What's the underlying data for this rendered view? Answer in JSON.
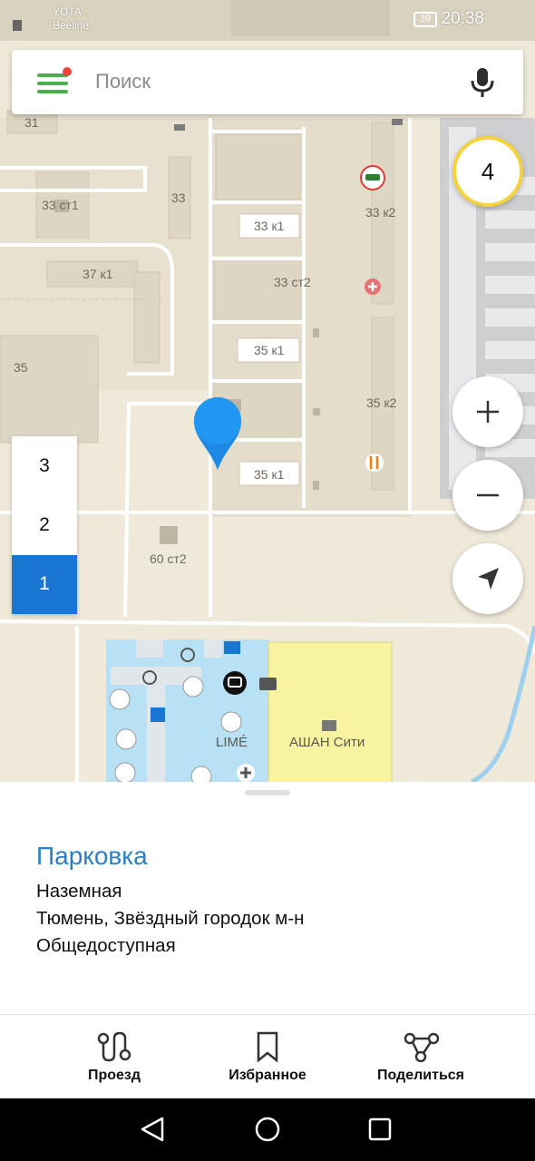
{
  "status_bar": {
    "carrier_1": "YOTA",
    "carrier_2": "Beeline",
    "battery": "39",
    "time": "20:38"
  },
  "search": {
    "placeholder": "Поиск",
    "menu_icon": "hamburger-menu-icon",
    "mic_icon": "microphone-icon"
  },
  "map": {
    "traffic_level": "4",
    "labels": [
      "31",
      "33 ст1",
      "33",
      "33 к1",
      "33 к2",
      "37 к1",
      "33 ст2",
      "35",
      "35 к1",
      "35 к2",
      "35 к1",
      "60 ст2",
      "LIMÉ",
      "АШАН Сити"
    ],
    "floors": [
      "3",
      "2",
      "1"
    ],
    "active_floor": "1",
    "zoom_in_icon": "plus-icon",
    "zoom_out_icon": "minus-icon",
    "locate_icon": "navigation-arrow-icon"
  },
  "place": {
    "title": "Парковка",
    "type": "Наземная",
    "address": "Тюмень, Звёздный городок м-н",
    "access": "Общедоступная"
  },
  "actions": [
    {
      "label": "Проезд",
      "icon": "route-icon"
    },
    {
      "label": "Избранное",
      "icon": "bookmark-icon"
    },
    {
      "label": "Поделиться",
      "icon": "share-icon"
    }
  ],
  "colors": {
    "accent_blue": "#1976d2",
    "title_blue": "#2b7fc4",
    "menu_green": "#4caf50",
    "traffic_yellow": "#f5d33d",
    "mall_yellow": "#f7f3a1",
    "mall_blue": "#b9e1f5"
  }
}
